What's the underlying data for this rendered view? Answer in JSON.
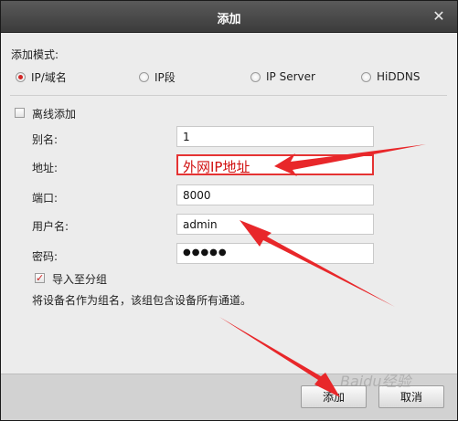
{
  "window": {
    "title": "添加"
  },
  "mode": {
    "label": "添加模式:",
    "options": [
      {
        "label": "IP/域名",
        "selected": true
      },
      {
        "label": "IP段",
        "selected": false
      },
      {
        "label": "IP Server",
        "selected": false
      },
      {
        "label": "HiDDNS",
        "selected": false
      }
    ]
  },
  "offline": {
    "label": "离线添加",
    "checked": false
  },
  "fields": {
    "alias": {
      "label": "别名:",
      "value": "1"
    },
    "address": {
      "label": "地址:",
      "value": "外网IP地址"
    },
    "port": {
      "label": "端口:",
      "value": "8000"
    },
    "username": {
      "label": "用户名:",
      "value": "admin"
    },
    "password": {
      "label": "密码:",
      "value": "●●●●●"
    }
  },
  "group": {
    "label": "导入至分组",
    "checked": true,
    "hint": "将设备名作为组名，该组包含设备所有通道。"
  },
  "buttons": {
    "add": "添加",
    "cancel": "取消"
  },
  "watermark": "Baidu经验",
  "annotation_color": "#e8272a",
  "icons": {
    "close": "close-icon"
  }
}
